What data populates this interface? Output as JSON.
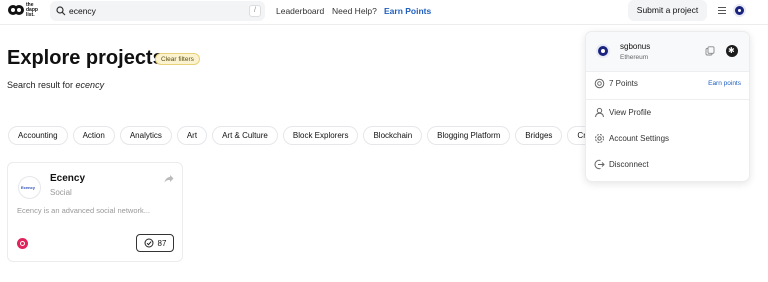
{
  "header": {
    "logo_text": "the dapp list.",
    "search_value": "ecency",
    "search_shortcut": "/",
    "nav": [
      "Leaderboard",
      "Need Help?",
      "Earn Points"
    ],
    "submit_label": "Submit a project"
  },
  "main": {
    "title": "Explore projects",
    "clear_filters": "Clear filters",
    "result_prefix": "Search result for",
    "result_query": "ecency",
    "categories": [
      "Accounting",
      "Action",
      "Analytics",
      "Art",
      "Art & Culture",
      "Block Explorers",
      "Blockchain",
      "Blogging Platform",
      "Bridges",
      "Cr"
    ]
  },
  "card": {
    "logo_text": "Ecency",
    "title": "Ecency",
    "category": "Social",
    "description": "Ecency is an advanced social network...",
    "votes": "87"
  },
  "dropdown": {
    "username": "sgbonus",
    "chain": "Ethereum",
    "points": "7 Points",
    "earn": "Earn points",
    "items": [
      "View Profile",
      "Account Settings",
      "Disconnect"
    ]
  },
  "colors": {
    "accent": "#1f5fbf",
    "avatar": "#1a237e",
    "badge": "#e0245e",
    "clear_filters_bg": "#fbf3d0"
  }
}
